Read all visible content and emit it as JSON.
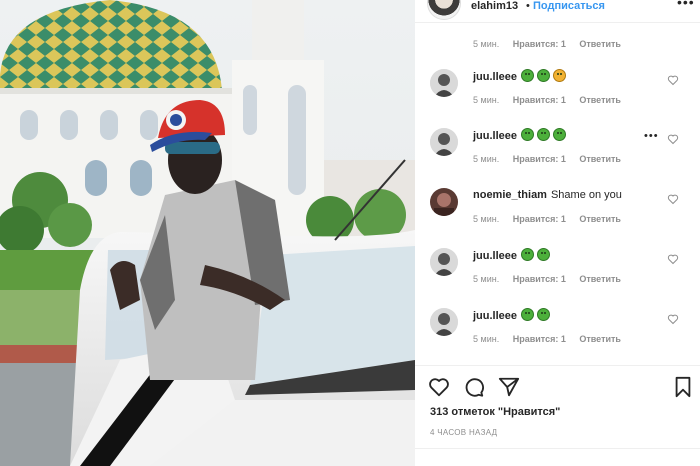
{
  "header": {
    "username": "elahim13",
    "separator": "•",
    "follow_label": "Подписаться",
    "more_label": "•••"
  },
  "first_meta": {
    "time": "5 мин.",
    "likes": "Нравится: 1",
    "reply": "Ответить"
  },
  "comments": [
    {
      "user": "juu.lleee",
      "text": "",
      "emojis": [
        "green",
        "green",
        "sad"
      ],
      "time": "5 мин.",
      "likes": "Нравится: 1",
      "reply": "Ответить",
      "show_dots": false
    },
    {
      "user": "juu.lleee",
      "text": "",
      "emojis": [
        "green",
        "green",
        "green"
      ],
      "time": "5 мин.",
      "likes": "Нравится: 1",
      "reply": "Ответить",
      "show_dots": true
    },
    {
      "user": "noemie_thiam",
      "text": "Shame on you",
      "emojis": [],
      "time": "5 мин.",
      "likes": "Нравится: 1",
      "reply": "Ответить",
      "show_dots": false
    },
    {
      "user": "juu.lleee",
      "text": "",
      "emojis": [
        "green",
        "green"
      ],
      "time": "5 мин.",
      "likes": "Нравится: 1",
      "reply": "Ответить",
      "show_dots": false
    },
    {
      "user": "juu.lleee",
      "text": "",
      "emojis": [
        "green",
        "green"
      ],
      "time": "5 мин.",
      "likes": "Нравится: 1",
      "reply": "Ответить",
      "show_dots": false
    }
  ],
  "actions": {
    "like_icon": "heart-icon",
    "comment_icon": "comment-icon",
    "share_icon": "paper-plane-icon",
    "save_icon": "bookmark-icon"
  },
  "likes_text": "313 отметок \"Нравится\"",
  "posted_time": "4 ЧАСОВ НАЗАД",
  "colors": {
    "link_blue": "#3897f0",
    "text_dark": "#262626",
    "text_gray": "#8e8e8e",
    "divider": "#efefef"
  }
}
